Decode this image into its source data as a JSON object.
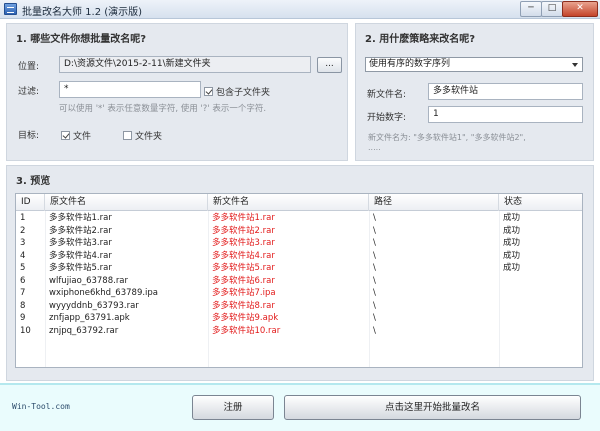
{
  "window": {
    "title": "批量改名大师 1.2 (演示版)",
    "min_label": "─",
    "max_label": "□",
    "close_label": "✕"
  },
  "section1": {
    "title": "1.  哪些文件你想批量改名呢?",
    "location_label": "位置:",
    "location_value": "D:\\资源文件\\2015-2-11\\新建文件夹",
    "browse_label": "...",
    "filter_label": "过滤:",
    "filter_value": "*",
    "include_subfolders_label": "包含子文件夹",
    "include_subfolders_checked": true,
    "hint": "可以使用 '*' 表示任意数量字符, 使用 '?' 表示一个字符.",
    "target_label": "目标:",
    "target_file_label": "文件",
    "target_file_checked": true,
    "target_folder_label": "文件夹",
    "target_folder_checked": false
  },
  "section2": {
    "title": "2.  用什麽策略来改名呢?",
    "strategy_selected": "使用有序的数字序列",
    "new_name_label": "新文件名:",
    "new_name_value": "多多软件站",
    "start_num_label": "开始数字:",
    "start_num_value": "1",
    "example_line1": "新文件名为: \"多多软件站1\", \"多多软件站2\",",
    "example_line2": "....."
  },
  "section3": {
    "title": "3.  预览",
    "columns": [
      "ID",
      "原文件名",
      "新文件名",
      "路径",
      "状态"
    ],
    "rows": [
      {
        "id": "1",
        "old": "多多软件站1.rar",
        "new": "多多软件站1.rar",
        "path": "\\",
        "status": "成功"
      },
      {
        "id": "2",
        "old": "多多软件站2.rar",
        "new": "多多软件站2.rar",
        "path": "\\",
        "status": "成功"
      },
      {
        "id": "3",
        "old": "多多软件站3.rar",
        "new": "多多软件站3.rar",
        "path": "\\",
        "status": "成功"
      },
      {
        "id": "4",
        "old": "多多软件站4.rar",
        "new": "多多软件站4.rar",
        "path": "\\",
        "status": "成功"
      },
      {
        "id": "5",
        "old": "多多软件站5.rar",
        "new": "多多软件站5.rar",
        "path": "\\",
        "status": "成功"
      },
      {
        "id": "6",
        "old": "wlfujiao_63788.rar",
        "new": "多多软件站6.rar",
        "path": "\\",
        "status": ""
      },
      {
        "id": "7",
        "old": "wxiphone6khd_63789.ipa",
        "new": "多多软件站7.ipa",
        "path": "\\",
        "status": ""
      },
      {
        "id": "8",
        "old": "wyyyddnb_63793.rar",
        "new": "多多软件站8.rar",
        "path": "\\",
        "status": ""
      },
      {
        "id": "9",
        "old": "znfjapp_63791.apk",
        "new": "多多软件站9.apk",
        "path": "\\",
        "status": ""
      },
      {
        "id": "10",
        "old": "znjpq_63792.rar",
        "new": "多多软件站10.rar",
        "path": "\\",
        "status": ""
      }
    ]
  },
  "bottom": {
    "brand": "Win-Tool.com",
    "register_label": "注册",
    "start_label": "点击这里开始批量改名"
  },
  "colors": {
    "panel_bg": "#e5e9ef",
    "new_name_text": "#e21b1b",
    "bottom_bg": "#eafcfd"
  }
}
